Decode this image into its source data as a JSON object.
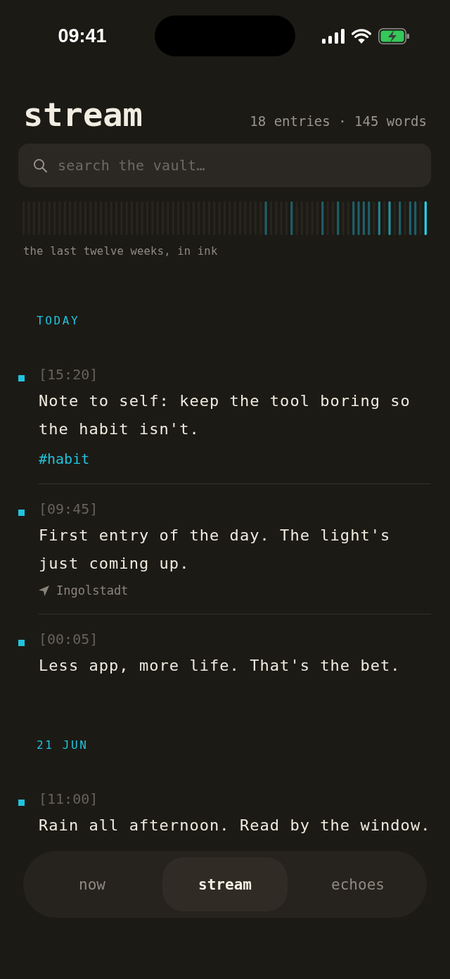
{
  "status_bar": {
    "time": "09:41"
  },
  "header": {
    "title": "stream",
    "summary": "18 entries · 145 words"
  },
  "search": {
    "placeholder": "search the vault…"
  },
  "activity": {
    "caption": "the last twelve weeks, in ink"
  },
  "sections": [
    {
      "label": "TODAY",
      "entries": [
        {
          "time": "[15:20]",
          "text": "Note to self: keep the tool boring so the habit isn't.",
          "tags": [
            "#habit"
          ]
        },
        {
          "time": "[09:45]",
          "text": "First entry of the day. The light's just coming up.",
          "location": "Ingolstadt"
        },
        {
          "time": "[00:05]",
          "text": "Less app, more life. That's the bet."
        }
      ]
    },
    {
      "label": "21 JUN",
      "entries": [
        {
          "time": "[11:00]",
          "text": "Rain all afternoon. Read by the window."
        }
      ]
    }
  ],
  "tabs": [
    {
      "label": "now",
      "selected": false
    },
    {
      "label": "stream",
      "selected": true
    },
    {
      "label": "echoes",
      "selected": false
    }
  ]
}
